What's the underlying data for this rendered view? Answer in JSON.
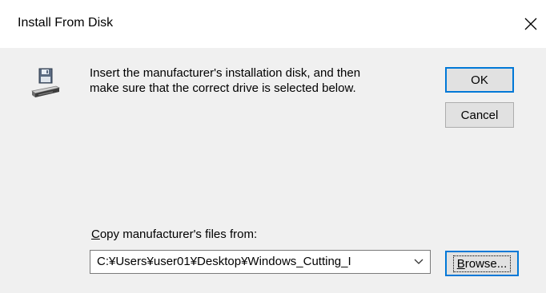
{
  "window": {
    "title": "Install From Disk",
    "close_icon": "close-icon"
  },
  "message": {
    "line1": "Insert the manufacturer's installation disk, and then",
    "line2": "make sure that the correct drive is selected below."
  },
  "icon": "floppy-disk-drive-icon",
  "buttons": {
    "ok_label": "OK",
    "cancel_label": "Cancel",
    "browse_label_access": "B",
    "browse_label_rest": "rowse..."
  },
  "copy": {
    "label_access": "C",
    "label_rest": "opy manufacturer's files from:",
    "path_value": "C:¥Users¥user01¥Desktop¥Windows_Cutting_I"
  },
  "colors": {
    "accent": "#0078d7",
    "dialog_bg": "#f0f0f0",
    "button_bg": "#e1e1e1"
  }
}
